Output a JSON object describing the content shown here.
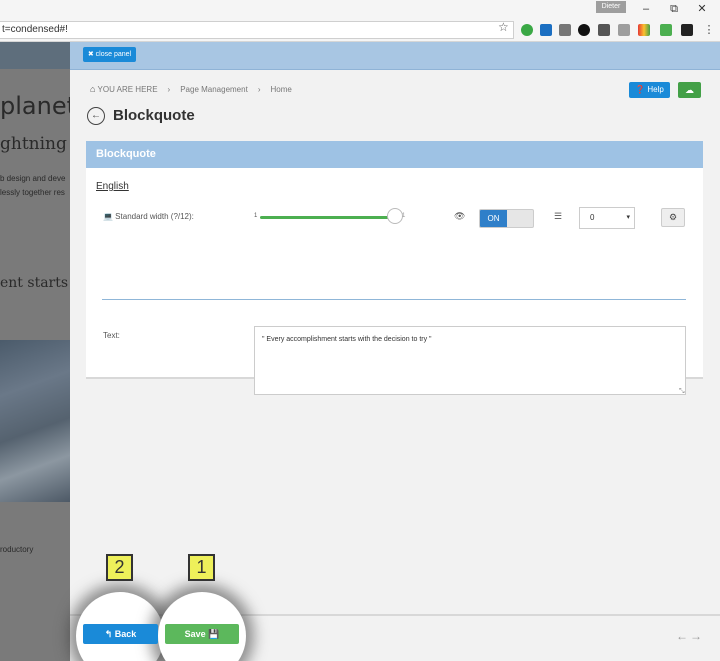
{
  "browser": {
    "user_chip": "Dieter",
    "url": "t=condensed#!",
    "star_icon": "☆",
    "window_controls": [
      "–",
      "⧉",
      "✕"
    ],
    "extension_colors": [
      "#3aa845",
      "#1b6fc2",
      "#777777",
      "#111111",
      "#555555",
      "#9e9e9e",
      "#e53935",
      "#4caf50",
      "#222222"
    ]
  },
  "background_page": {
    "heading": "planet",
    "subheading": "ghtning f",
    "line1": "b design and deve",
    "line2": "lessly together res",
    "quote_fragment": "ent starts w",
    "footer_fragment": "roductory"
  },
  "panel": {
    "close_label": "✖ close panel",
    "breadcrumb": {
      "home_icon": "⌂",
      "here": "YOU ARE HERE",
      "sep": "›",
      "item1": "Page Management",
      "item2": "Home"
    },
    "help_label": "❓ Help",
    "cloud_icon": "☁",
    "back_arrow": "←",
    "title": "Blockquote",
    "card": {
      "header": "Blockquote",
      "language": "English",
      "width_label": "💻 Standard width (?/12):",
      "slider_min": "1",
      "slider_max": "1",
      "slider_value_fraction": 0.92,
      "eye_icon": "👁",
      "toggle_on": "ON",
      "list_icon": "☰",
      "select_value": "0",
      "select_caret": "▾",
      "gear_icon": "⚙",
      "text_label": "Text:",
      "text_value": "\" Every accomplishment starts with the decision to try \"",
      "grip": "⤡"
    },
    "footer": {
      "back_label": "↰ Back",
      "save_label": "Save 💾",
      "nav_arrows": "←→"
    }
  },
  "callouts": [
    "2",
    "1"
  ],
  "colors": {
    "primary": "#1a8ad8",
    "success": "#5cb85c",
    "header_blue": "#9ec2e4",
    "callout": "#eef05a"
  }
}
